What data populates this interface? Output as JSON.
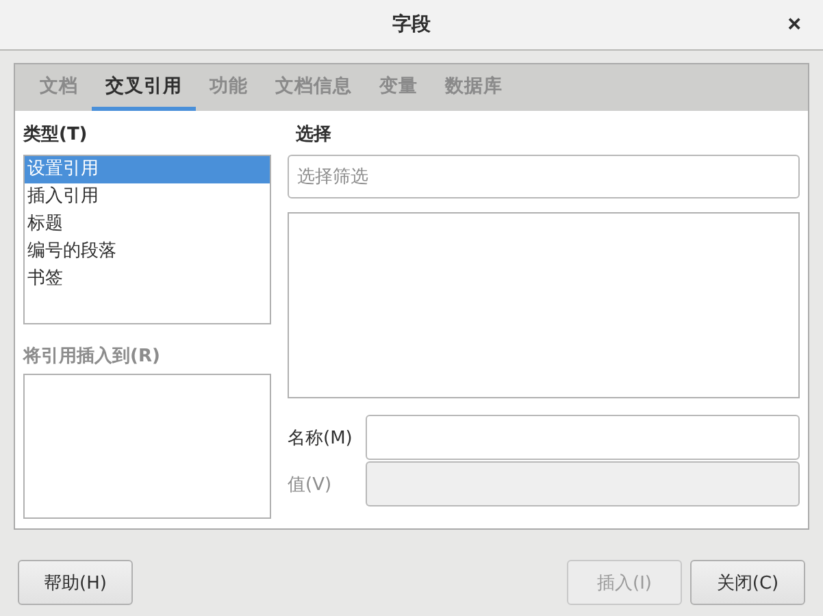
{
  "window": {
    "title": "字段",
    "close": "×"
  },
  "tabs": [
    {
      "label": "文档",
      "selected": false
    },
    {
      "label": "交叉引用",
      "selected": true
    },
    {
      "label": "功能",
      "selected": false
    },
    {
      "label": "文档信息",
      "selected": false
    },
    {
      "label": "变量",
      "selected": false
    },
    {
      "label": "数据库",
      "selected": false
    }
  ],
  "type_list": {
    "label": "类型(T)",
    "items": [
      {
        "label": "设置引用",
        "selected": true
      },
      {
        "label": "插入引用",
        "selected": false
      },
      {
        "label": "标题",
        "selected": false
      },
      {
        "label": "编号的段落",
        "selected": false
      },
      {
        "label": "书签",
        "selected": false
      }
    ]
  },
  "insert_to": {
    "label": "将引用插入到(R)",
    "disabled": true
  },
  "selection": {
    "label": "选择",
    "filter": {
      "placeholder": "选择筛选"
    }
  },
  "name_field": {
    "label": "名称(M)",
    "disabled": false
  },
  "value_field": {
    "label": "值(V)",
    "disabled": true
  },
  "buttons": [
    {
      "label": "帮助(H)",
      "disabled": false,
      "kind": "left"
    },
    {
      "label": "插入(I)",
      "disabled": true,
      "kind": "right"
    },
    {
      "label": "关闭(C)",
      "disabled": false,
      "kind": "right"
    }
  ]
}
